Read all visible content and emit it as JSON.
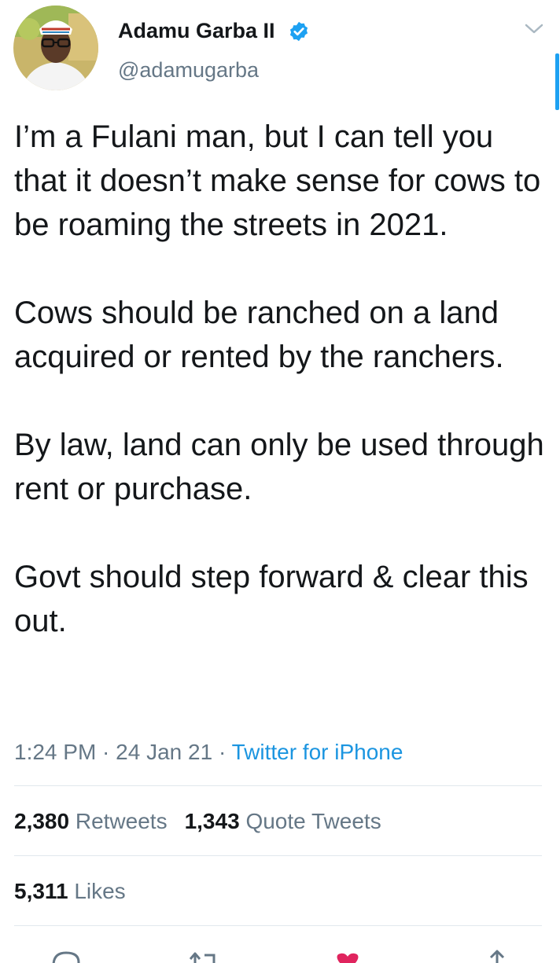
{
  "author": {
    "name": "Adamu Garba II",
    "handle": "@adamugarba",
    "verified_icon": "verified-badge-icon"
  },
  "tweet": {
    "paragraphs": [
      "I’m a Fulani man, but I can tell you that it doesn’t make sense for cows to be roaming the streets in 2021.",
      "Cows should be ranched on a land acquired or rented by the ranchers.",
      "By law, land can only be used through rent or purchase.",
      "Govt should step forward & clear this out."
    ],
    "time": "1:24 PM",
    "separator": " · ",
    "date": "24 Jan 21",
    "source": "Twitter for iPhone"
  },
  "stats": {
    "retweets_count": "2,380",
    "retweets_label": "Retweets",
    "quote_count": "1,343",
    "quote_label": "Quote Tweets",
    "likes_count": "5,311",
    "likes_label": "Likes"
  },
  "colors": {
    "accent": "#1da1f2",
    "like": "#e0245e",
    "secondary_text": "#657786"
  },
  "actions": [
    "reply-icon",
    "retweet-icon",
    "like-icon",
    "share-icon"
  ]
}
